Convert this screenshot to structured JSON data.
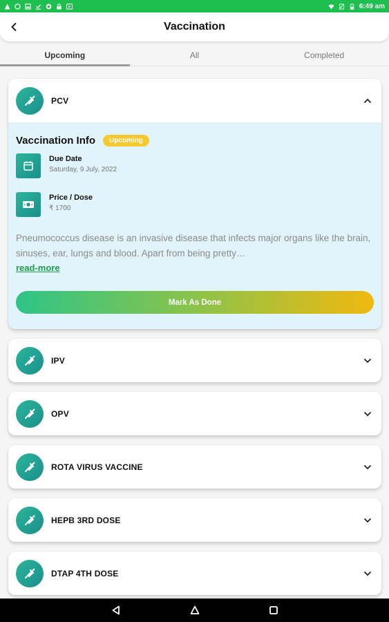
{
  "status_bar": {
    "time": "6:49 am",
    "left_icons": [
      "warning-icon",
      "whatsapp-icon",
      "gallery-icon",
      "download-done-icon",
      "browser-icon",
      "lock-icon",
      "play-icon"
    ],
    "right_icons": [
      "wifi-icon",
      "no-sim-icon",
      "battery-icon"
    ]
  },
  "header": {
    "title": "Vaccination",
    "back_icon": "chevron-left-icon"
  },
  "tabs": [
    {
      "label": "Upcoming",
      "active": true
    },
    {
      "label": "All",
      "active": false
    },
    {
      "label": "Completed",
      "active": false
    }
  ],
  "vaccines": [
    {
      "name": "PCV",
      "expanded": true,
      "details": {
        "section_title": "Vaccination Info",
        "status_badge": "Upcoming",
        "due_date_label": "Due Date",
        "due_date_value": "Saturday, 9 July, 2022",
        "price_label": "Price / Dose",
        "price_value": "₹ 1700",
        "description": "Pneumococcus disease is an invasive disease that infects major organs like the brain, sinuses, ear, lungs and blood. Apart from being pretty…",
        "read_more": "read-more",
        "action_button": "Mark As Done"
      }
    },
    {
      "name": "IPV",
      "expanded": false
    },
    {
      "name": "OPV",
      "expanded": false
    },
    {
      "name": "ROTA VIRUS VACCINE",
      "expanded": false
    },
    {
      "name": "HEPB 3RD DOSE",
      "expanded": false
    },
    {
      "name": "DTAP 4TH DOSE",
      "expanded": false
    }
  ],
  "colors": {
    "status_bar": "#1fbf4f",
    "icon_teal": "#1b8f8c",
    "badge_yellow": "#f7c830",
    "info_bg": "#e2f4fb",
    "link_green": "#1f9c4e",
    "button_gradient_start": "#2ec487",
    "button_gradient_end": "#f0b910"
  },
  "nav_bar": [
    "back-triangle-icon",
    "home-circle-icon",
    "recents-square-icon"
  ]
}
